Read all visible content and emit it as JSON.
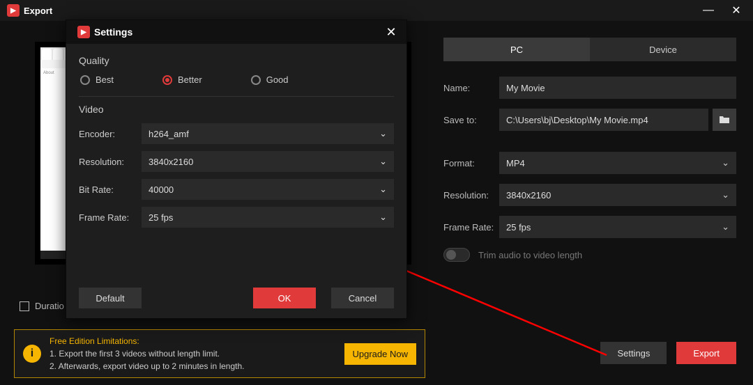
{
  "window": {
    "title": "Export"
  },
  "tabs": {
    "pc": "PC",
    "device": "Device"
  },
  "fields": {
    "name_label": "Name:",
    "name_value": "My Movie",
    "save_label": "Save to:",
    "save_value": "C:\\Users\\bj\\Desktop\\My Movie.mp4",
    "format_label": "Format:",
    "format_value": "MP4",
    "res_label": "Resolution:",
    "res_value": "3840x2160",
    "fps_label": "Frame Rate:",
    "fps_value": "25 fps",
    "trim_label": "Trim audio to video length"
  },
  "duration_label": "Duratio",
  "notice": {
    "heading": "Free Edition Limitations:",
    "line1": "1. Export the first 3 videos without length limit.",
    "line2": "2. Afterwards, export video up to 2 minutes in length.",
    "upgrade": "Upgrade Now"
  },
  "buttons": {
    "settings": "Settings",
    "export": "Export"
  },
  "modal": {
    "title": "Settings",
    "quality_label": "Quality",
    "quality": {
      "best": "Best",
      "better": "Better",
      "good": "Good"
    },
    "video_label": "Video",
    "encoder_label": "Encoder:",
    "encoder_value": "h264_amf",
    "res_label": "Resolution:",
    "res_value": "3840x2160",
    "bitrate_label": "Bit Rate:",
    "bitrate_value": "40000",
    "fps_label": "Frame Rate:",
    "fps_value": "25 fps",
    "default": "Default",
    "ok": "OK",
    "cancel": "Cancel"
  }
}
